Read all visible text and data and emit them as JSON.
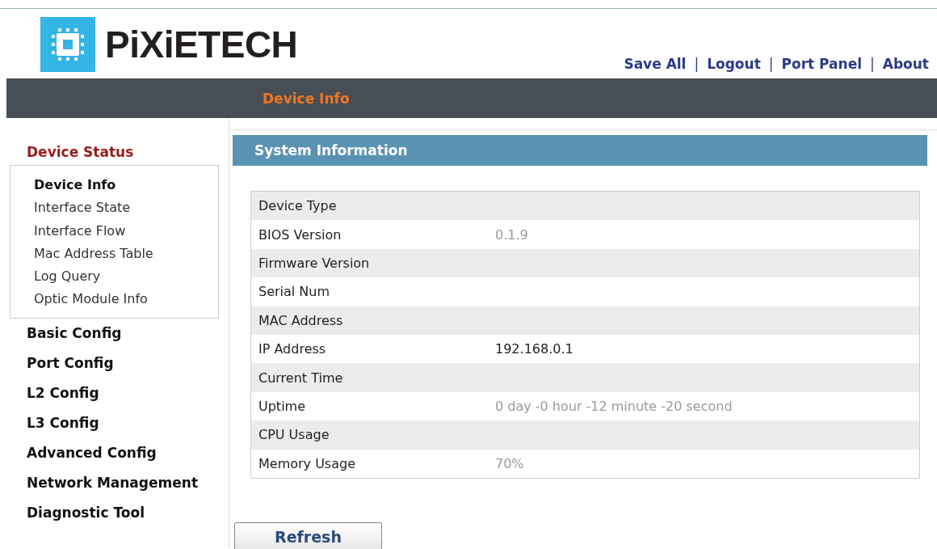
{
  "header": {
    "logo": "PiXiETECH",
    "links": [
      "Save All",
      "Logout",
      "Port Panel",
      "About"
    ],
    "separator": "|"
  },
  "nav_bar": {
    "title": "Device Info"
  },
  "sidebar": {
    "items": [
      {
        "label": "Device Status",
        "expanded": true,
        "children": [
          {
            "label": "Device Info",
            "selected": true
          },
          {
            "label": "Interface State",
            "selected": false
          },
          {
            "label": "Interface Flow",
            "selected": false
          },
          {
            "label": "Mac Address Table",
            "selected": false
          },
          {
            "label": "Log Query",
            "selected": false
          },
          {
            "label": "Optic Module Info",
            "selected": false
          }
        ]
      },
      {
        "label": "Basic Config",
        "expanded": false
      },
      {
        "label": "Port Config",
        "expanded": false
      },
      {
        "label": "L2 Config",
        "expanded": false
      },
      {
        "label": "L3 Config",
        "expanded": false
      },
      {
        "label": "Advanced Config",
        "expanded": false
      },
      {
        "label": "Network Management",
        "expanded": false
      },
      {
        "label": "Diagnostic Tool",
        "expanded": false
      }
    ]
  },
  "section": {
    "title": "System Information"
  },
  "table": {
    "rows": [
      {
        "label": "Device Type"
      },
      {
        "label": "BIOS Version",
        "value": "0.1.9",
        "faded": true
      },
      {
        "label": "Firmware Version"
      },
      {
        "label": "Serial Num"
      },
      {
        "label": "MAC Address"
      },
      {
        "label": "IP Address",
        "value": "192.168.0.1",
        "faded": false
      },
      {
        "label": "Current Time"
      },
      {
        "label": "Uptime",
        "value": "0 day -0 hour -12 minute -20 second",
        "faded": true
      },
      {
        "label": "CPU Usage"
      },
      {
        "label": "Memory Usage",
        "value": "70%",
        "faded": true
      }
    ]
  },
  "buttons": [
    "Refresh"
  ]
}
